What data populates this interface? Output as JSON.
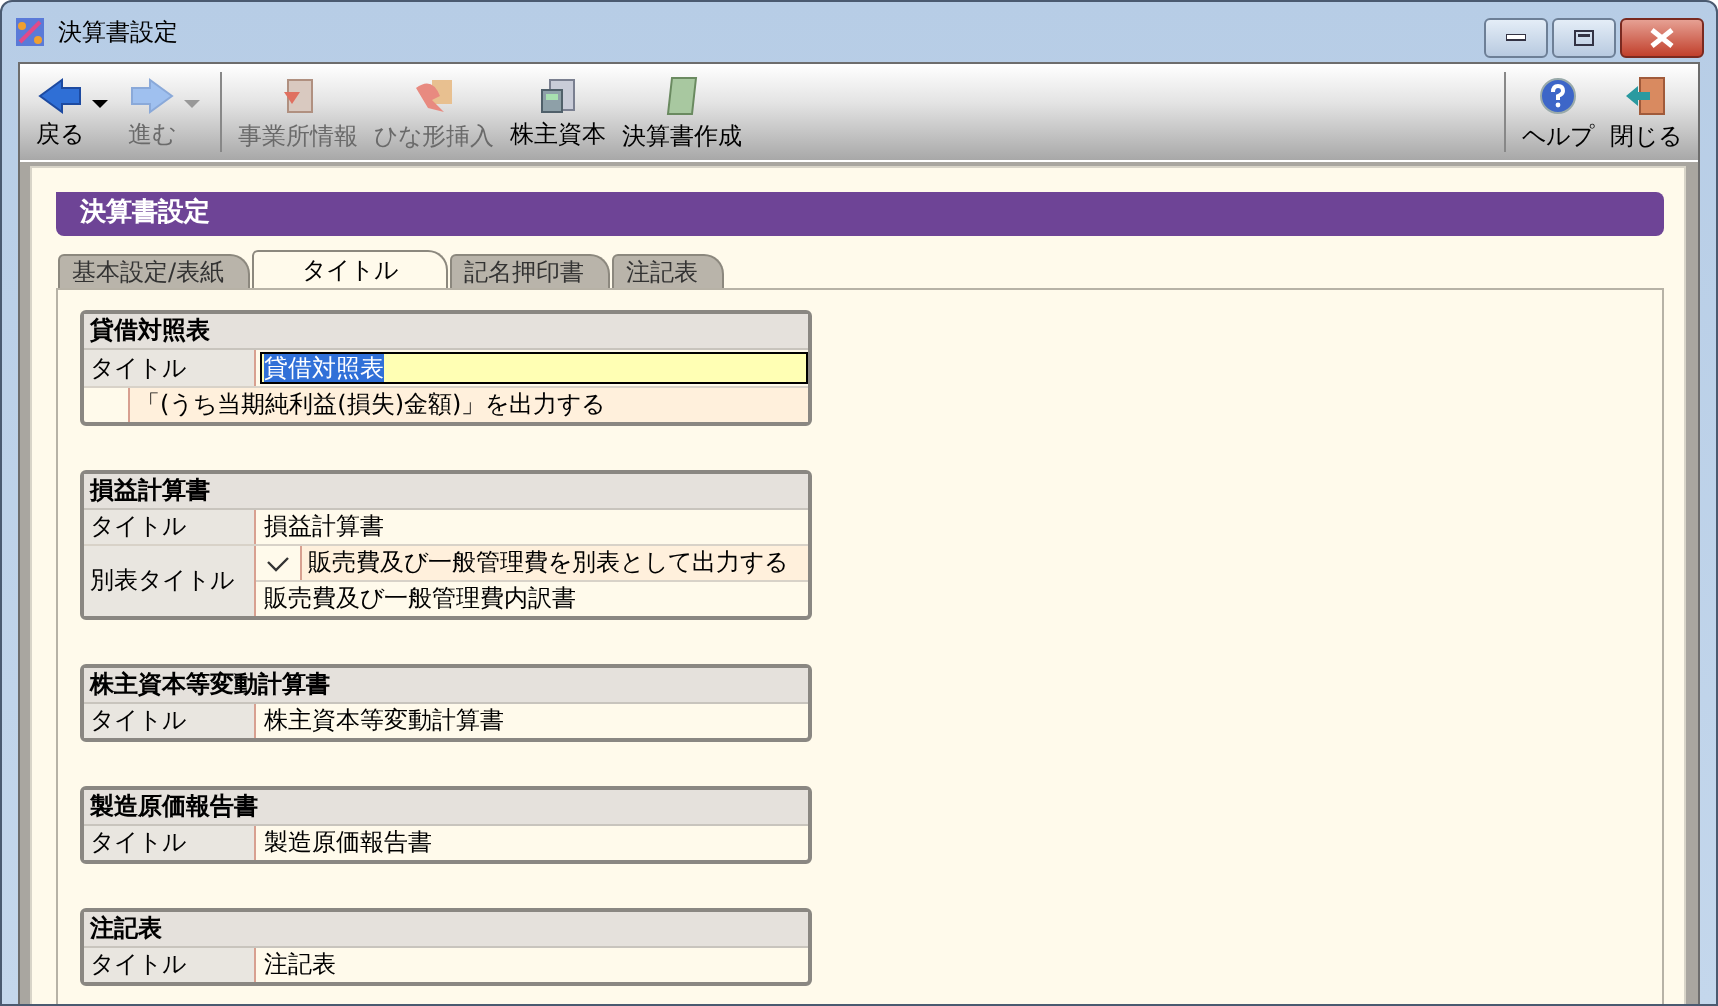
{
  "window": {
    "title": "決算書設定"
  },
  "toolbar": {
    "left": [
      {
        "kind": "back",
        "label": "戻る",
        "disabled": false,
        "dropdown": true
      },
      {
        "kind": "forward",
        "label": "進む",
        "disabled": true,
        "dropdown": true
      },
      {
        "kind": "office",
        "label": "事業所情報",
        "disabled": true,
        "dropdown": false
      },
      {
        "kind": "template",
        "label": "ひな形挿入",
        "disabled": true,
        "dropdown": false
      },
      {
        "kind": "capital",
        "label": "株主資本",
        "disabled": false,
        "dropdown": false
      },
      {
        "kind": "statement",
        "label": "決算書作成",
        "disabled": false,
        "dropdown": false
      }
    ],
    "right": [
      {
        "kind": "help",
        "label": "ヘルプ",
        "disabled": false,
        "dropdown": false
      },
      {
        "kind": "exit",
        "label": "閉じる",
        "disabled": false,
        "dropdown": false
      }
    ]
  },
  "header": "決算書設定",
  "tabs": [
    {
      "label": "基本設定/表紙",
      "selected": false
    },
    {
      "label": "タイトル",
      "selected": true
    },
    {
      "label": "記名押印書",
      "selected": false
    },
    {
      "label": "注記表",
      "selected": false
    }
  ],
  "sections": [
    {
      "title": "貸借対照表",
      "rows": [
        {
          "kind": "field",
          "label": "タイトル",
          "value": "貸借対照表",
          "focused": true
        },
        {
          "kind": "option",
          "checked": false,
          "text": "「(うち当期純利益(損失)金額)」を出力する"
        }
      ]
    },
    {
      "title": "損益計算書",
      "rows": [
        {
          "kind": "field",
          "label": "タイトル",
          "value": "損益計算書",
          "focused": false
        },
        {
          "kind": "group",
          "label": "別表タイトル",
          "checked": true,
          "text": "販売費及び一般管理費を別表として出力する",
          "value": "販売費及び一般管理費内訳書"
        }
      ]
    },
    {
      "title": "株主資本等変動計算書",
      "rows": [
        {
          "kind": "field",
          "label": "タイトル",
          "value": "株主資本等変動計算書",
          "focused": false
        }
      ]
    },
    {
      "title": "製造原価報告書",
      "rows": [
        {
          "kind": "field",
          "label": "タイトル",
          "value": "製造原価報告書",
          "focused": false
        }
      ]
    },
    {
      "title": "注記表",
      "rows": [
        {
          "kind": "field",
          "label": "タイトル",
          "value": "注記表",
          "focused": false
        }
      ]
    }
  ]
}
